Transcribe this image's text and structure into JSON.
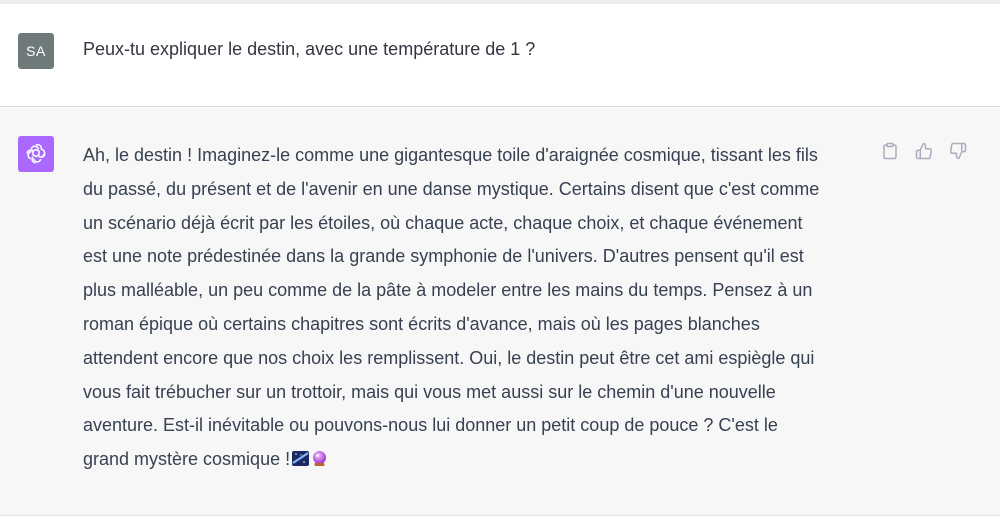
{
  "user_message": {
    "avatar_initials": "SA",
    "text": "Peux-tu expliquer le destin, avec une température de 1 ?"
  },
  "assistant_message": {
    "lines": [
      "Ah, le destin ! Imaginez-le comme une gigantesque toile d'araignée cosmique, tissant les fils",
      "du passé, du présent et de l'avenir en une danse mystique. Certains disent que c'est comme",
      "un scénario déjà écrit par les étoiles, où chaque acte, chaque choix, et chaque événement",
      "est une note prédestinée dans la grande symphonie de l'univers. D'autres pensent qu'il est",
      "plus malléable, un peu comme de la pâte à modeler entre les mains du temps. Pensez à un",
      "roman épique où certains chapitres sont écrits d'avance, mais où les pages blanches",
      "attendent encore que nos choix les remplissent. Oui, le destin peut être cet ami espiègle qui",
      "vous fait trébucher sur un trottoir, mais qui vous met aussi sur le chemin d'une nouvelle",
      "aventure. Est-il inévitable ou pouvons-nous lui donner un petit coup de pouce ? C'est le",
      "grand mystère cosmique !"
    ],
    "trailing_emojis": [
      "milky-way-emoji",
      "crystal-ball-emoji"
    ]
  },
  "actions": {
    "copy_icon": "clipboard-icon",
    "thumbs_up_icon": "thumbs-up-icon",
    "thumbs_down_icon": "thumbs-down-icon"
  },
  "colors": {
    "user_avatar_bg": "#6e7a7a",
    "assistant_avatar_bg": "#ab68ff",
    "assistant_row_bg": "#f7f7f8",
    "text": "#374151"
  }
}
